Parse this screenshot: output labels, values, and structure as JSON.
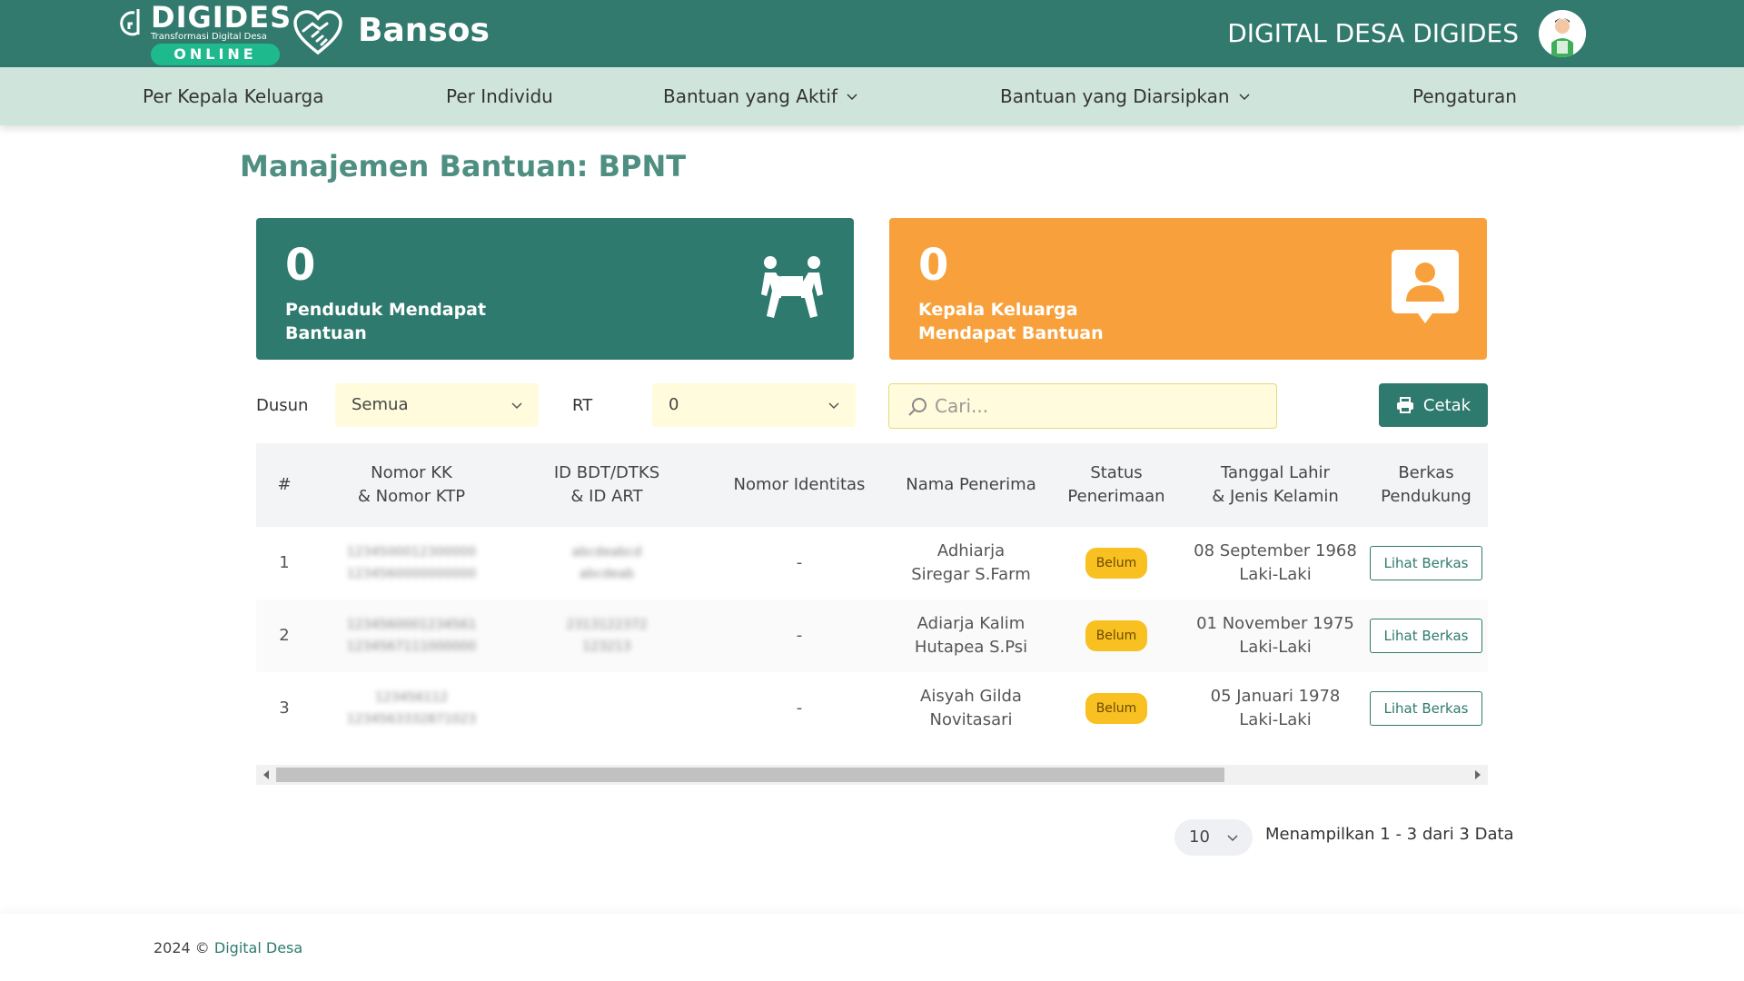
{
  "header": {
    "logo_word": "DIGIDES",
    "logo_tagline": "Transformasi Digital Desa",
    "logo_badge": "ONLINE",
    "app_title": "Bansos",
    "org_name": "DIGITAL DESA DIGIDES"
  },
  "nav": {
    "items": [
      {
        "label": "Per Kepala Keluarga"
      },
      {
        "label": "Per Individu"
      },
      {
        "label": "Bantuan yang Aktif"
      },
      {
        "label": "Bantuan yang Diarsipkan"
      },
      {
        "label": "Pengaturan"
      }
    ]
  },
  "page": {
    "title": "Manajemen Bantuan: BPNT"
  },
  "stats": [
    {
      "value": "0",
      "label": "Penduduk Mendapat Bantuan",
      "color": "#2f7a6e"
    },
    {
      "value": "0",
      "label": "Kepala Keluarga Mendapat Bantuan",
      "color": "#f8a13c"
    }
  ],
  "filters": {
    "dusun_label": "Dusun",
    "dusun_value": "Semua",
    "rt_label": "RT",
    "rt_value": "0",
    "search_placeholder": "Cari...",
    "print_label": "Cetak"
  },
  "table": {
    "headers": [
      "#",
      "Nomor KK\n& Nomor KTP",
      "ID BDT/DTKS\n& ID ART",
      "Nomor Identitas",
      "Nama Penerima",
      "Status\nPenerimaan",
      "Tanggal Lahir\n& Jenis Kelamin",
      "Berkas\nPendukung"
    ],
    "rows": [
      {
        "no": "1",
        "kk": "1234500012300000",
        "ktp": "1234560000000000",
        "bdt": "abcdeabcd",
        "art": "abcdeab",
        "identitas": "-",
        "nama": "Adhiarja Siregar S.Farm",
        "status": "Belum",
        "tanggal": "08 September 1968",
        "gender": "Laki-Laki",
        "berkas": "Lihat Berkas"
      },
      {
        "no": "2",
        "kk": "1234560001234561",
        "ktp": "1234567111000000",
        "bdt": "2313122372",
        "art": "123213",
        "identitas": "-",
        "nama": "Adiarja Kalim Hutapea S.Psi",
        "status": "Belum",
        "tanggal": "01 November 1975",
        "gender": "Laki-Laki",
        "berkas": "Lihat Berkas"
      },
      {
        "no": "3",
        "kk": "123456112",
        "ktp": "1234563332871023",
        "bdt": "",
        "art": "",
        "identitas": "-",
        "nama": "Aisyah Gilda Novitasari",
        "status": "Belum",
        "tanggal": "05 Januari 1978",
        "gender": "Laki-Laki",
        "berkas": "Lihat Berkas"
      }
    ]
  },
  "pagination": {
    "page_size": "10",
    "info": "Menampilkan 1 - 3 dari 3 Data"
  },
  "footer": {
    "copyright": "2024 ©",
    "link": "Digital Desa"
  },
  "colors": {
    "header": "#327a6e",
    "nav": "#cfe5dc",
    "accent": "#2f7a6e",
    "orange": "#f8a13c",
    "badge": "#f8c021"
  }
}
